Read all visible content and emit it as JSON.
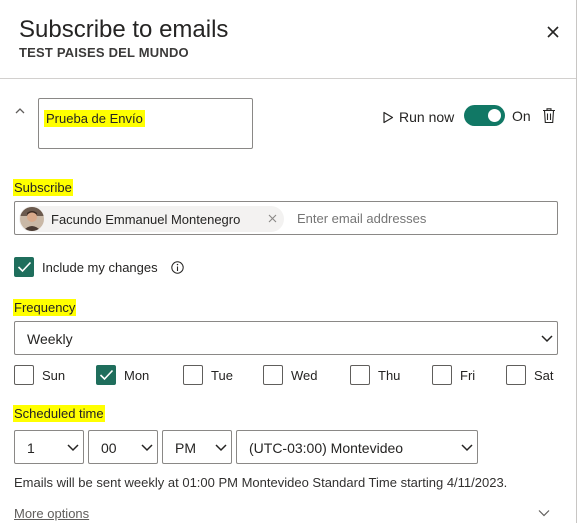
{
  "header": {
    "title": "Subscribe to emails",
    "subtitle": "TEST PAISES DEL MUNDO"
  },
  "subscription": {
    "name": "Prueba de Envío",
    "run_now_label": "Run now",
    "toggle_state_label": "On",
    "toggle_on": true
  },
  "subscribe": {
    "label": "Subscribe",
    "recipients": [
      {
        "name": "Facundo Emmanuel Montenegro"
      }
    ],
    "email_placeholder": "Enter email addresses"
  },
  "include_changes": {
    "label": "Include my changes",
    "checked": true
  },
  "frequency": {
    "label": "Frequency",
    "selected": "Weekly",
    "days": [
      {
        "label": "Sun",
        "checked": false
      },
      {
        "label": "Mon",
        "checked": true
      },
      {
        "label": "Tue",
        "checked": false
      },
      {
        "label": "Wed",
        "checked": false
      },
      {
        "label": "Thu",
        "checked": false
      },
      {
        "label": "Fri",
        "checked": false
      },
      {
        "label": "Sat",
        "checked": false
      }
    ]
  },
  "scheduled_time": {
    "label": "Scheduled time",
    "hour": "1",
    "minute": "00",
    "ampm": "PM",
    "timezone": "(UTC-03:00) Montevideo"
  },
  "summary": "Emails will be sent weekly at 01:00 PM Montevideo Standard Time starting 4/11/2023.",
  "more_options_label": "More options",
  "colors": {
    "accent": "#117865",
    "highlight": "#ffff00"
  }
}
